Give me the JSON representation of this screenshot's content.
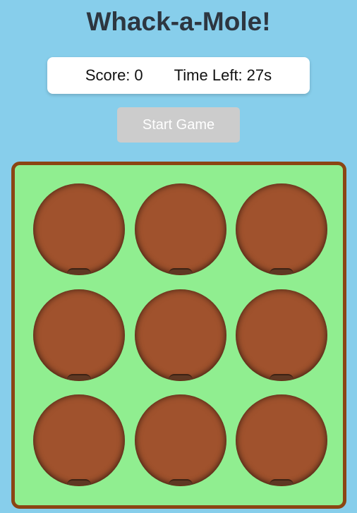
{
  "title": "Whack-a-Mole!",
  "scoreboard": {
    "score_label": "Score:",
    "score_value": "0",
    "time_label": "Time Left:",
    "time_value": "27s"
  },
  "start_button": {
    "label": "Start Game",
    "state": "disabled"
  },
  "board": {
    "rows": 3,
    "columns": 3,
    "holes": [
      {
        "id": 1,
        "mole_visible": false
      },
      {
        "id": 2,
        "mole_visible": false
      },
      {
        "id": 3,
        "mole_visible": false
      },
      {
        "id": 4,
        "mole_visible": false
      },
      {
        "id": 5,
        "mole_visible": false
      },
      {
        "id": 6,
        "mole_visible": false
      },
      {
        "id": 7,
        "mole_visible": false
      },
      {
        "id": 8,
        "mole_visible": false
      },
      {
        "id": 9,
        "mole_visible": false
      }
    ]
  },
  "colors": {
    "background": "#87ceeb",
    "title_text": "#2d3640",
    "scoreboard_bg": "#ffffff",
    "button_disabled_bg": "#cccccc",
    "button_text": "#ffffff",
    "board_grass": "#90ee90",
    "board_border": "#8b4513",
    "hole_dirt": "#a0522d",
    "mole": "#5e3823"
  }
}
